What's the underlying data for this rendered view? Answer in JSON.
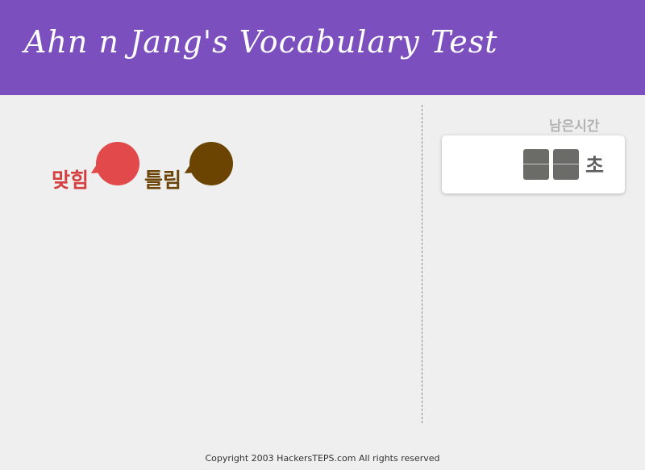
{
  "header": {
    "title": "Ahn n Jang's Vocabulary Test",
    "background": "#7b4fbd"
  },
  "score": {
    "correct_label": "맞힘",
    "wrong_label": "틀림",
    "correct_color": "#e2494a",
    "wrong_color": "#6a4400"
  },
  "timer": {
    "label": "남은시간",
    "unit": "초"
  },
  "footer": {
    "copyright": "Copyright 2003 HackersTEPS.com All rights reserved"
  }
}
